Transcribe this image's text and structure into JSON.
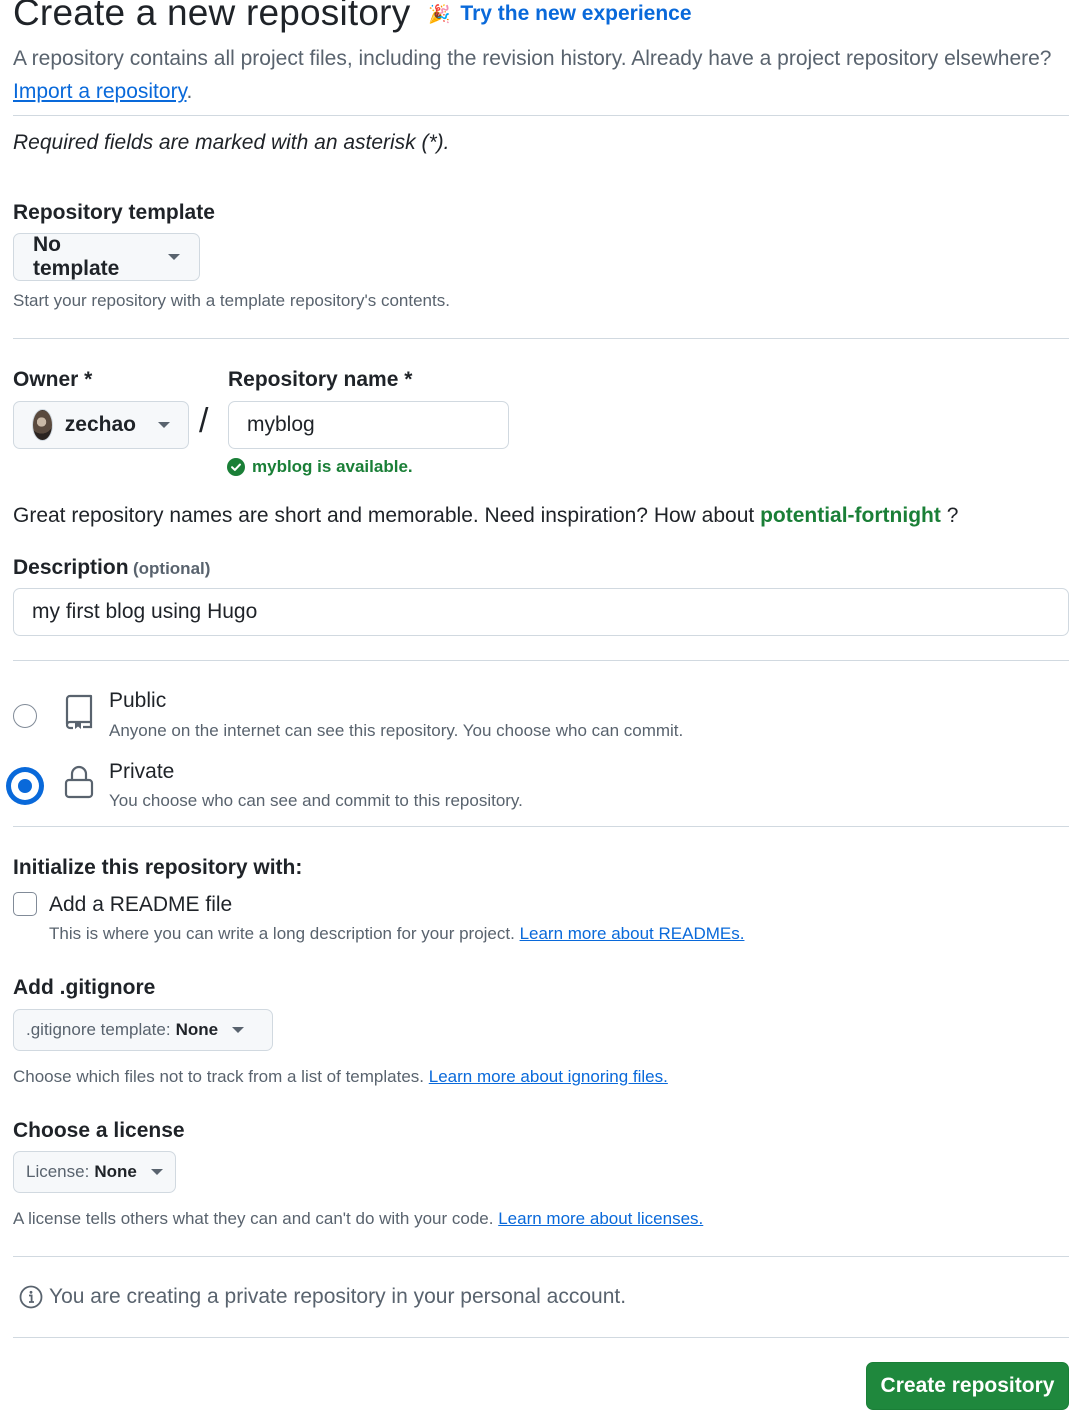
{
  "header": {
    "title": "Create a new repository",
    "try_link": "Try the new experience",
    "intro_text": "A repository contains all project files, including the revision history. Already have a project repository elsewhere?",
    "import_link": "Import a repository",
    "required_note": "Required fields are marked with an asterisk (*)."
  },
  "template": {
    "label": "Repository template",
    "button": "No template",
    "hint": "Start your repository with a template repository's contents."
  },
  "owner": {
    "label": "Owner *",
    "value": "zechao"
  },
  "repo": {
    "label": "Repository name *",
    "value": "myblog",
    "available": "myblog is available."
  },
  "inspiration": {
    "text": "Great repository names are short and memorable. Need inspiration? How about",
    "suggestion": "potential-fortnight",
    "suffix": "?"
  },
  "description": {
    "label": "Description",
    "optional": "(optional)",
    "value": "my first blog using Hugo"
  },
  "visibility": {
    "public_title": "Public",
    "public_desc": "Anyone on the internet can see this repository. You choose who can commit.",
    "private_title": "Private",
    "private_desc": "You choose who can see and commit to this repository.",
    "selected": "private"
  },
  "init": {
    "label": "Initialize this repository with:",
    "readme_label": "Add a README file",
    "readme_checked": false,
    "readme_desc": "This is where you can write a long description for your project.",
    "readme_link": "Learn more about READMEs."
  },
  "gitignore": {
    "label": "Add .gitignore",
    "button_prefix": ".gitignore template:",
    "button_value": "None",
    "hint": "Choose which files not to track from a list of templates.",
    "hint_link": "Learn more about ignoring files."
  },
  "license": {
    "label": "Choose a license",
    "button_prefix": "License:",
    "button_value": "None",
    "hint": "A license tells others what they can and can't do with your code.",
    "hint_link": "Learn more about licenses."
  },
  "info": {
    "text": "You are creating a private repository in your personal account."
  },
  "submit": {
    "label": "Create repository"
  },
  "colors": {
    "accent": "#0969da",
    "success": "#1a7f37",
    "button_green": "#1f883d"
  }
}
